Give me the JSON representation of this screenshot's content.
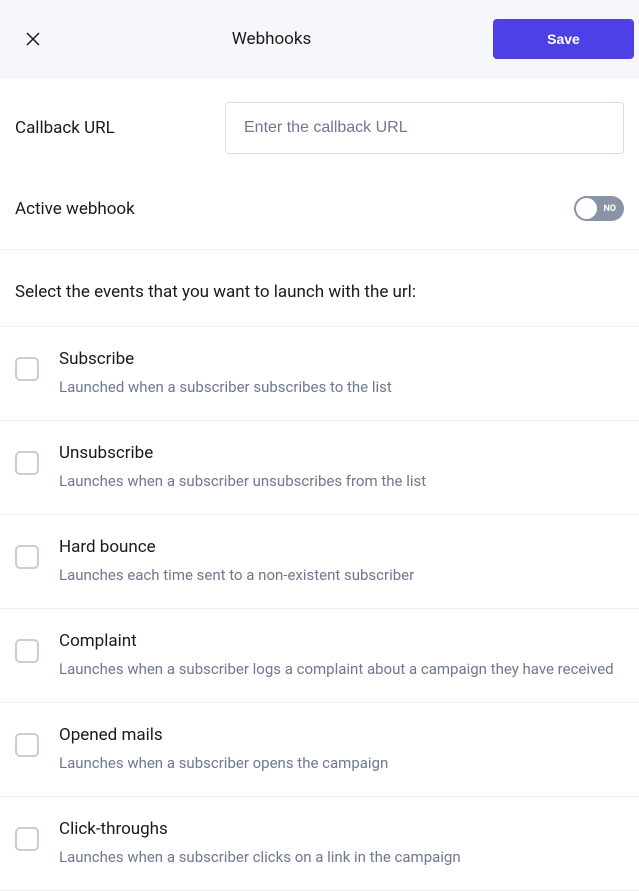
{
  "header": {
    "title": "Webhooks",
    "save_label": "Save"
  },
  "callback": {
    "label": "Callback URL",
    "placeholder": "Enter the callback URL",
    "value": ""
  },
  "active_webhook": {
    "label": "Active webhook",
    "state": "NO"
  },
  "events_section_label": "Select the events that you want to launch with the url:",
  "events": [
    {
      "title": "Subscribe",
      "desc": "Launched when a subscriber subscribes to the list"
    },
    {
      "title": "Unsubscribe",
      "desc": "Launches when a subscriber unsubscribes from the list"
    },
    {
      "title": "Hard bounce",
      "desc": "Launches each time sent to a non-existent subscriber"
    },
    {
      "title": "Complaint",
      "desc": "Launches when a subscriber logs a complaint about a campaign they have received"
    },
    {
      "title": "Opened mails",
      "desc": "Launches when a subscriber opens the campaign"
    },
    {
      "title": "Click-throughs",
      "desc": "Launches when a subscriber clicks on a link in the campaign"
    }
  ]
}
